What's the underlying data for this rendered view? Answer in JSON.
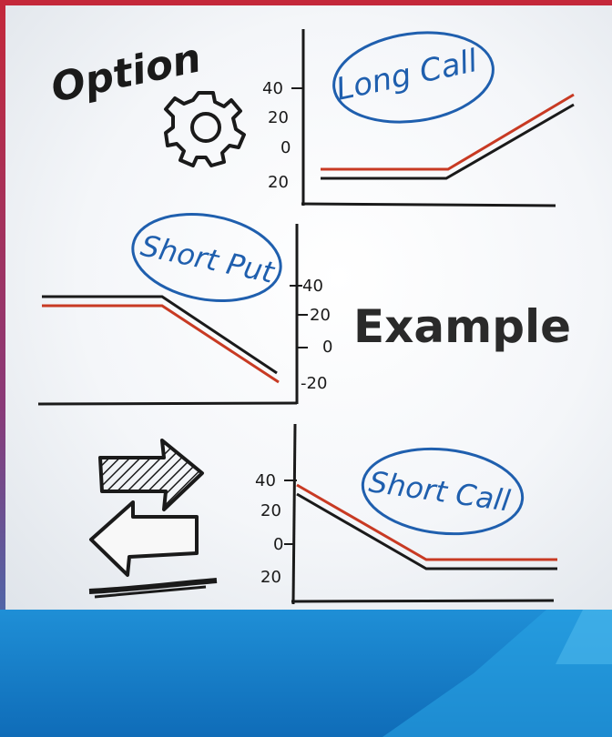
{
  "title_word": "Option",
  "center_word": "Example",
  "panels": [
    {
      "label": "Long Call",
      "ticks": [
        "40",
        "20",
        "0",
        "20"
      ]
    },
    {
      "label": "Short Put",
      "ticks": [
        "40",
        "20",
        "0",
        "-20"
      ]
    },
    {
      "label": "Short Call",
      "ticks": [
        "40",
        "20",
        "0",
        "20"
      ]
    }
  ],
  "colors": {
    "ink": "#1a1a1a",
    "red_line": "#c83a23",
    "blue_ink": "#1f5fae",
    "footer_blue": "#1a84cf"
  },
  "icons": [
    "gear-icon",
    "swap-arrows-icon"
  ]
}
